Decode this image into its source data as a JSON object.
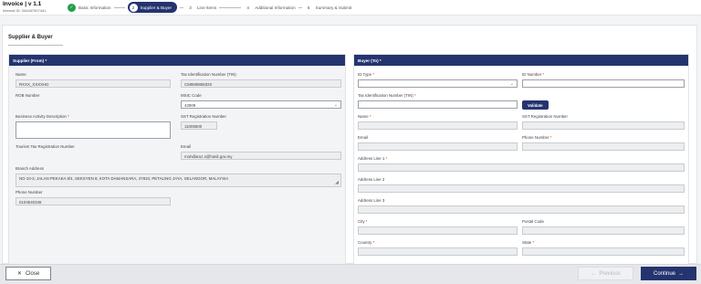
{
  "header": {
    "title": "Invoice | v 1.1",
    "subtitle": "Internal ID: 344487007441"
  },
  "steps": [
    {
      "num": "✓",
      "label": "Basic Information",
      "state": "done"
    },
    {
      "num": "2",
      "label": "Supplier & Buyer",
      "state": "active"
    },
    {
      "num": "3",
      "label": "Line Items",
      "state": "todo"
    },
    {
      "num": "4",
      "label": "Additional Information",
      "state": "todo"
    },
    {
      "num": "5",
      "label": "Summary & Submit",
      "state": "todo"
    }
  ],
  "section_title": "Supplier & Buyer",
  "supplier": {
    "header": "Supplier (From) *",
    "name_label": "Name",
    "name_value": "RXXX_XXXXHD",
    "tin_label": "Tax Identification Number (TIN)",
    "tin_value": "C58689856020",
    "rob_label": "ROB Number",
    "msic_label": "MSIC Code",
    "msic_value": "42909",
    "bad_label": "Business Activity Description",
    "bad_req": "*",
    "sst_label": "SST Registration Number",
    "sst_value": "11005500",
    "ttr_label": "Tourism Tax Registration Number",
    "email_label": "Email",
    "email_value": "mohdlaruz.s@hasil.gov.my",
    "branch_label": "Branch Address",
    "branch_value": "NO 10-3, JALAN PEKAKA 8/4, SEKSYEN 8, KOTA DAMANSARA, 47810, PETALING JAYA, SELANGOR, MALAYSIA",
    "phone_label": "Phone Number",
    "phone_value": "0104540346"
  },
  "buyer": {
    "header": "Buyer (To) *",
    "idtype_label": "ID Type",
    "idnum_label": "ID Number",
    "tin_label": "Tax Identification Number (TIN)",
    "validate_label": "Validate",
    "name_label": "Name",
    "sst_label": "SST Registration Number",
    "email_label": "Email",
    "phone_label": "Phone Number",
    "addr1_label": "Address Line 1",
    "addr2_label": "Address Line 2",
    "addr3_label": "Address Line 3",
    "city_label": "City",
    "postal_label": "Postal Code",
    "country_label": "Country",
    "state_label": "State",
    "req": "*"
  },
  "footer": {
    "close_label": "Close",
    "prev_label": "Previous",
    "continue_label": "Continue"
  },
  "colors": {
    "primary": "#24346f",
    "success": "#22a04a"
  }
}
